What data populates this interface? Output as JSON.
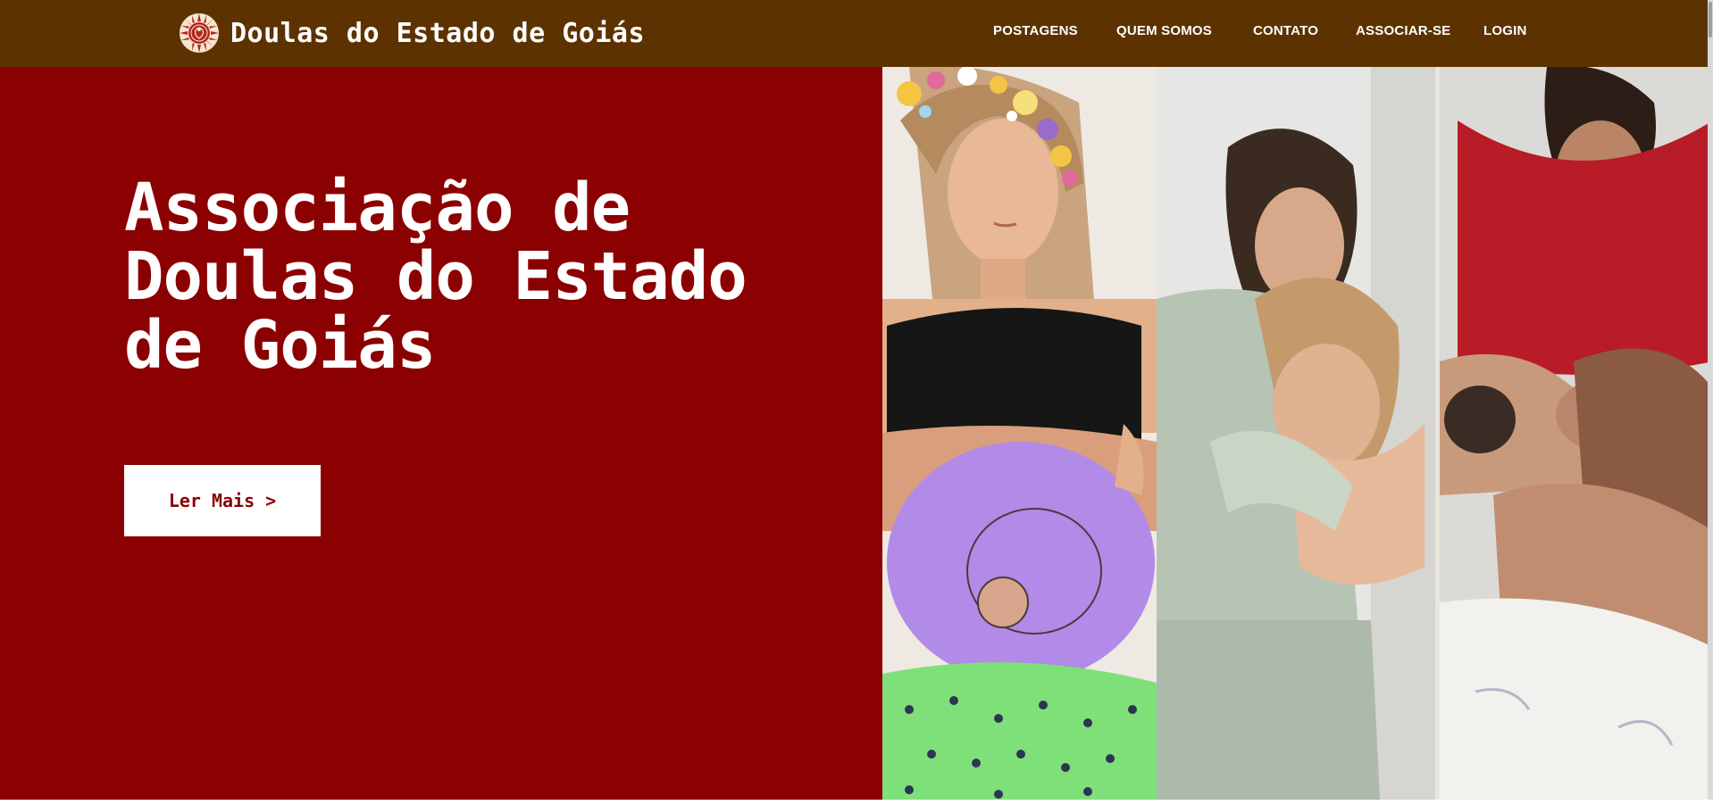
{
  "header": {
    "site_title": "Doulas do Estado de Goiás",
    "logo_icon": "sunflower-emblem-icon",
    "nav": [
      {
        "label": "POSTAGENS"
      },
      {
        "label": "QUEM SOMOS"
      },
      {
        "label": "CONTATO"
      },
      {
        "label": "ASSOCIAR-SE"
      },
      {
        "label": "LOGIN"
      }
    ]
  },
  "hero": {
    "title": "Associação de Doulas do Estado de Goiás",
    "button_label": "Ler Mais",
    "button_icon": "chevron-right-icon",
    "button_glyph": ">"
  },
  "photos": [
    {
      "icon": "pregnant-woman-belly-painting-photo"
    },
    {
      "icon": "doula-embracing-woman-photo"
    },
    {
      "icon": "mother-with-newborn-photo"
    }
  ],
  "colors": {
    "header_bg": "#5c3300",
    "hero_bg": "#8b0000",
    "text_light": "#ffffff"
  }
}
